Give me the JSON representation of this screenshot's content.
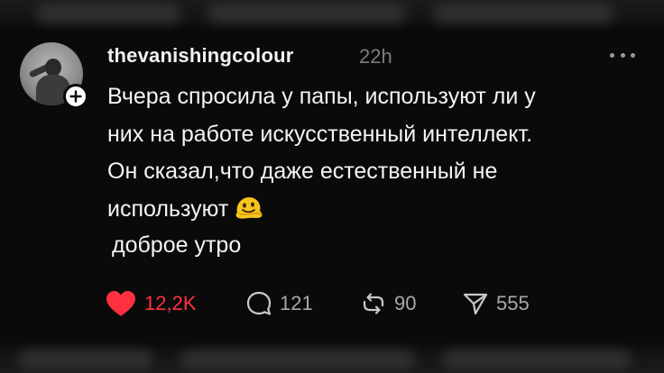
{
  "post": {
    "username": "thevanishingcolour",
    "time": "22h",
    "text_lines": [
      "Вчера спросила у папы, используют ли у",
      "них на работе искусственный интеллект.",
      "Он сказал,что даже естественный не",
      "используют"
    ],
    "second_text": "доброе утро",
    "emoji": "melting-face-emoji"
  },
  "actions": {
    "likes": "12,2K",
    "comments": "121",
    "reposts": "90",
    "shares": "555"
  },
  "colors": {
    "like_active": "#ff3040",
    "text": "#f4f4f4",
    "muted": "#7d7d7d",
    "background": "#0a0a0a"
  }
}
